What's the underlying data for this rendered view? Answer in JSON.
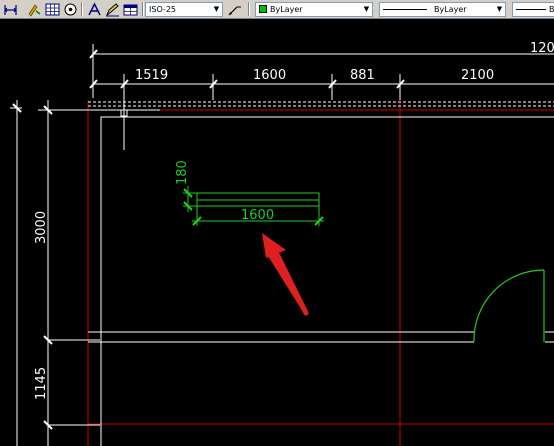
{
  "toolbar": {
    "icons": [
      "dimension-tool-icon",
      "edit-pick-icon",
      "table-grid-icon",
      "target-circle-icon",
      "text-style-icon",
      "pencil-edit-icon",
      "table-style-icon",
      "multileader-style-icon"
    ],
    "dim_style": "ISO-25",
    "layer": "ByLayer",
    "linetype": "ByLayer",
    "lineweight": "By",
    "layer_color": "#00c000"
  },
  "drawing": {
    "dims_top": {
      "overall": "120",
      "segments": [
        "1519",
        "1600",
        "881",
        "2100"
      ]
    },
    "dims_left": [
      "3000",
      "1145"
    ],
    "object_dims": {
      "height": "180",
      "length": "1600"
    },
    "colors": {
      "dimension": "#ffffff",
      "wall": "#ffffff",
      "redline": "#cc0000",
      "object": "#22cc22",
      "arrow": "#e02020"
    }
  }
}
